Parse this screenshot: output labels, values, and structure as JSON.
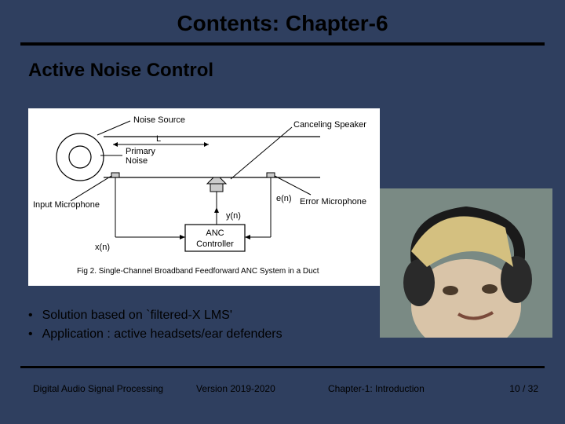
{
  "title": "Contents: Chapter-6",
  "subtitle": "Active Noise Control",
  "diagram": {
    "noise_source": "Noise Source",
    "canceling_speaker": "Canceling Speaker",
    "primary_noise": "Primary\nNoise",
    "input_mic": "Input Microphone",
    "error_mic": "Error Microphone",
    "L": "L",
    "e": "e(n)",
    "y": "y(n)",
    "x": "x(n)",
    "anc": "ANC\nController",
    "caption": "Fig 2. Single-Channel Broadband Feedforward ANC System in a Duct"
  },
  "bullets": [
    "Solution based on `filtered-X LMS'",
    "Application : active headsets/ear defenders"
  ],
  "footer": {
    "left": "Digital Audio Signal Processing",
    "mid": "Version 2019-2020",
    "chapter": "Chapter-1: Introduction",
    "page_current": "10",
    "page_sep": " / ",
    "page_total": "32"
  }
}
